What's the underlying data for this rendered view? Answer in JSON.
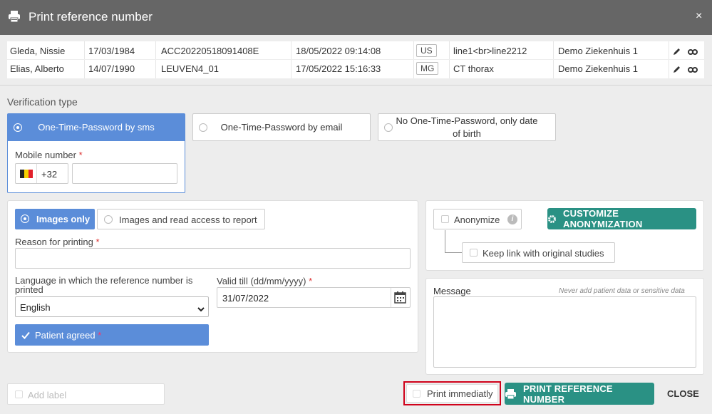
{
  "dialog": {
    "title": "Print reference number",
    "close": "×"
  },
  "studies": [
    {
      "patient": "Gleda, Nissie",
      "dob": "17/03/1984",
      "accession": "ACC20220518091408E",
      "datetime": "18/05/2022 09:14:08",
      "modality": "US",
      "description": "line1<br>line2212",
      "hospital": "Demo Ziekenhuis 1"
    },
    {
      "patient": "Elias, Alberto",
      "dob": "14/07/1990",
      "accession": "LEUVEN4_01",
      "datetime": "17/05/2022 15:16:33",
      "modality": "MG",
      "description": "CT thorax",
      "hospital": "Demo Ziekenhuis 1"
    }
  ],
  "verification": {
    "label": "Verification type",
    "options": [
      "One-Time-Password by sms",
      "One-Time-Password by email",
      "No One-Time-Password, only date of birth"
    ],
    "mobile_label": "Mobile number",
    "country_code": "+32",
    "mobile_value": ""
  },
  "access": {
    "options": [
      "Images only",
      "Images and read access to report"
    ],
    "reason_label": "Reason for printing",
    "reason_value": "",
    "language_label": "Language in which the reference number is printed",
    "language_value": "English",
    "valid_label": "Valid till (dd/mm/yyyy)",
    "valid_value": "31/07/2022",
    "patient_agreed": "Patient agreed"
  },
  "anonymize": {
    "label": "Anonymize",
    "customize": "CUSTOMIZE ANONYMIZATION",
    "keep_link": "Keep link with original studies"
  },
  "message": {
    "label": "Message",
    "hint": "Never add patient data or sensitive data",
    "value": ""
  },
  "footer": {
    "add_label": "Add label",
    "print_immediately": "Print immediatly",
    "print_button": "PRINT REFERENCE NUMBER",
    "close_button": "CLOSE"
  },
  "colors": {
    "accent": "#5b8dd9",
    "teal": "#2a9184",
    "titlebar": "#666666",
    "highlight": "#d0021b"
  }
}
